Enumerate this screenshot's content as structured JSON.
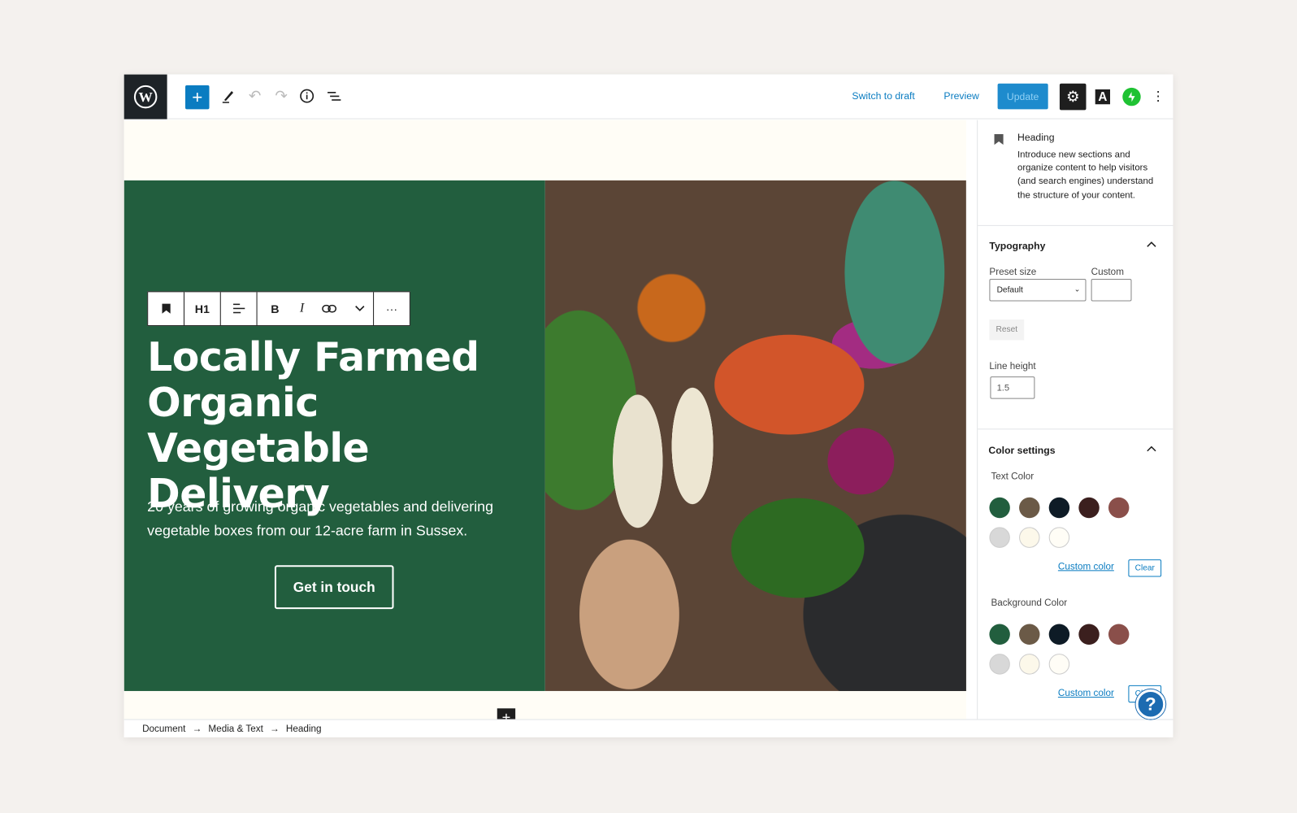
{
  "topbar": {
    "switch_to_draft": "Switch to draft",
    "preview": "Preview",
    "update": "Update",
    "font_icon_letter": "A"
  },
  "block_toolbar": {
    "heading_level": "H1",
    "bold": "B",
    "italic": "I",
    "more": "···"
  },
  "content": {
    "heading": "Locally Farmed Organic Vegetable Delivery",
    "subtext": "20 years of growing organic vegetables and delivering vegetable boxes from our 12-acre farm in Sussex.",
    "cta": "Get in touch"
  },
  "sidebar": {
    "block_name": "Heading",
    "block_description": "Introduce new sections and organize content to help visitors (and search engines) understand the structure of your content.",
    "typography": {
      "title": "Typography",
      "preset_label": "Preset size",
      "preset_value": "Default",
      "custom_label": "Custom",
      "custom_value": "",
      "reset": "Reset",
      "line_height_label": "Line height",
      "line_height_value": "1.5"
    },
    "color": {
      "title": "Color settings",
      "text_color_label": "Text Color",
      "background_color_label": "Background Color",
      "custom_color": "Custom color",
      "clear": "Clear",
      "palette": [
        "#225e3e",
        "#6b5a47",
        "#0e1b26",
        "#3b1f1e",
        "#8a4f4a",
        "#d8d8d8",
        "#fcf8ea",
        "#fffdf6"
      ]
    }
  },
  "breadcrumb": [
    "Document",
    "Media & Text",
    "Heading"
  ],
  "colors": {
    "accent": "#0a7cc1",
    "hero_green": "#225e3e",
    "jetpack": "#1fc233"
  }
}
